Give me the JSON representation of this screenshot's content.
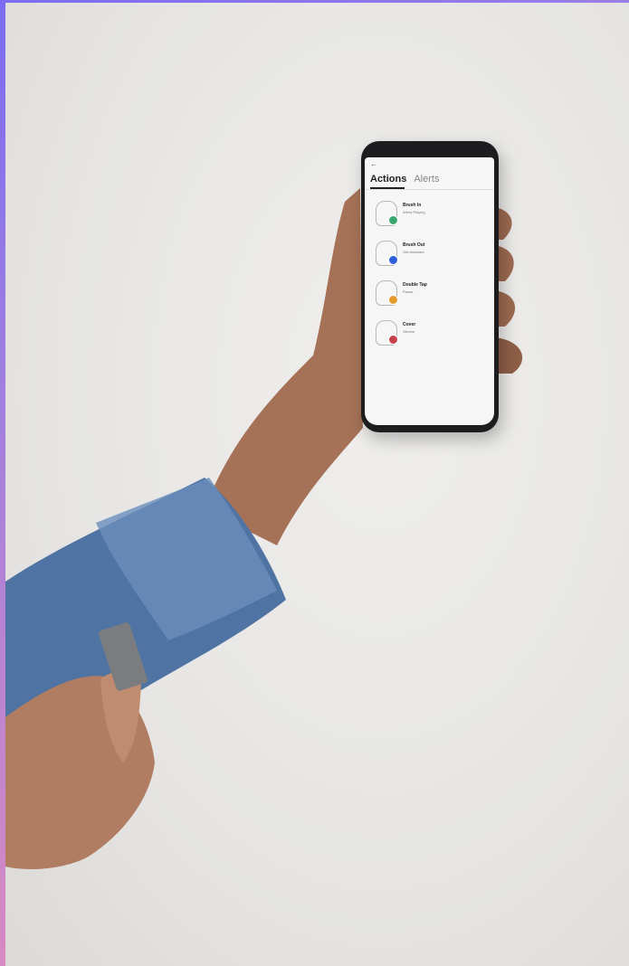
{
  "app": {
    "tabs": [
      {
        "label": "Actions",
        "active": true
      },
      {
        "label": "Alerts",
        "active": false
      }
    ],
    "items": [
      {
        "title": "Brush In",
        "subtitle": "Weird Playing",
        "color": "#3aa76d"
      },
      {
        "title": "Brush Out",
        "subtitle": "Get Assistant",
        "color": "#2d5fd8"
      },
      {
        "title": "Double Tap",
        "subtitle": "Pause",
        "color": "#e39a2c"
      },
      {
        "title": "Cover",
        "subtitle": "Silence",
        "color": "#c8404a"
      }
    ]
  },
  "colors": {
    "background": "#e9e8e6",
    "denim": "#4f74a3",
    "skin": "#a57257",
    "phone_body": "#1d1d20"
  },
  "icons": {
    "back": "back-arrow-icon",
    "gesture": "gesture-hand-icon"
  }
}
